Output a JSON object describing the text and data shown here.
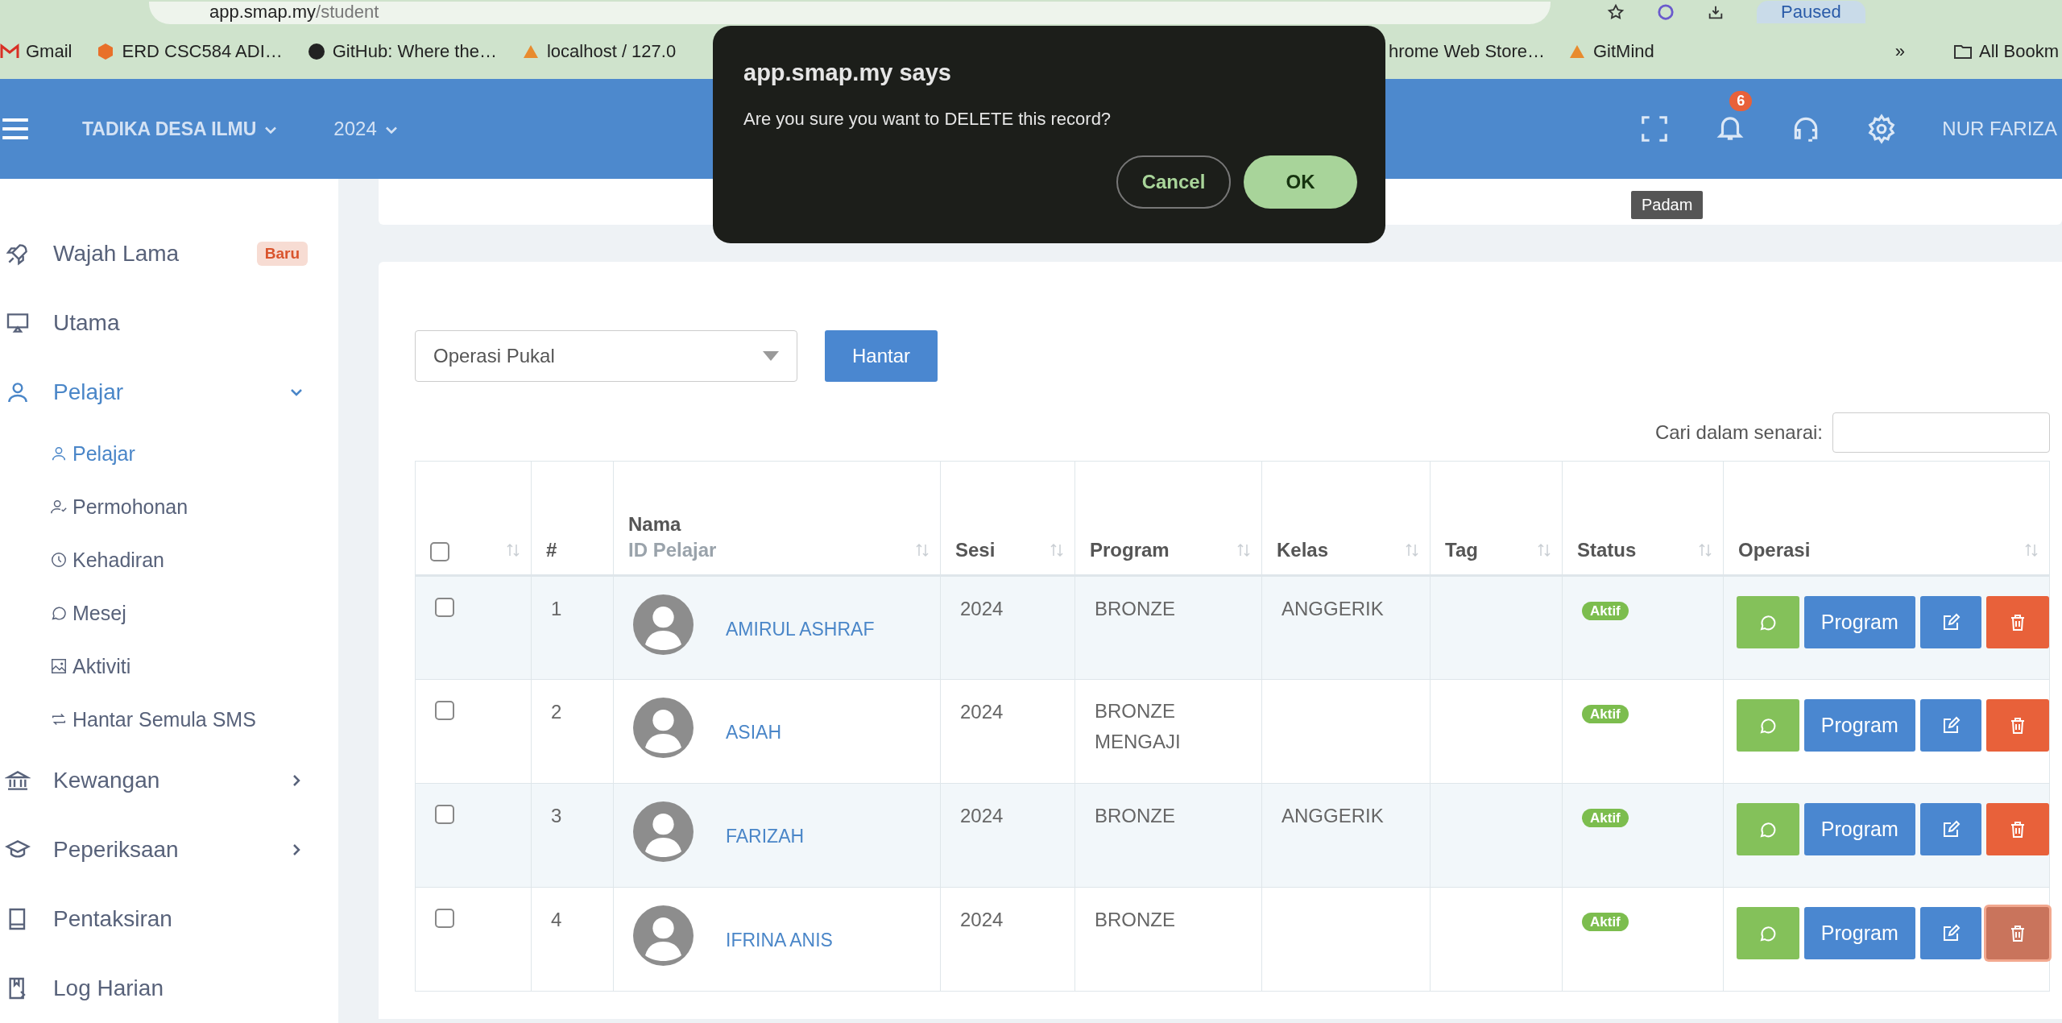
{
  "browser": {
    "url_host": "app.smap.my",
    "url_path": "/student",
    "profile_button": "Paused",
    "bookmarks": [
      {
        "label": "Gmail"
      },
      {
        "label": "ERD CSC584 ADI…"
      },
      {
        "label": "GitHub: Where the…"
      },
      {
        "label": "localhost / 127.0"
      },
      {
        "label": "hrome Web Store…"
      },
      {
        "label": "GitMind"
      }
    ],
    "more": "»",
    "all_bookmarks": "All Bookm"
  },
  "header": {
    "school": "TADIKA DESA ILMU",
    "year": "2024",
    "notification_count": "6",
    "user": "NUR FARIZA",
    "tooltip": "Padam"
  },
  "dialog": {
    "title": "app.smap.my says",
    "message": "Are you sure you want to DELETE this record?",
    "buttons": [
      {
        "label": "Cancel",
        "kind": "cancel"
      },
      {
        "label": "OK",
        "kind": "ok"
      }
    ]
  },
  "sidebar": {
    "items": [
      {
        "label": "Wajah Lama",
        "badge": "Baru",
        "selected": false
      },
      {
        "label": "Utama",
        "selected": false
      },
      {
        "label": "Pelajar",
        "selected": true,
        "expanded": true,
        "children": [
          {
            "label": "Pelajar",
            "selected": true
          },
          {
            "label": "Permohonan",
            "selected": false
          },
          {
            "label": "Kehadiran",
            "selected": false
          },
          {
            "label": "Mesej",
            "selected": false
          },
          {
            "label": "Aktiviti",
            "selected": false
          },
          {
            "label": "Hantar Semula SMS",
            "selected": false
          }
        ]
      },
      {
        "label": "Kewangan",
        "selected": false,
        "expanded": false
      },
      {
        "label": "Peperiksaan",
        "selected": false,
        "expanded": false
      },
      {
        "label": "Pentaksiran",
        "selected": false
      },
      {
        "label": "Log Harian",
        "selected": false
      }
    ]
  },
  "bulk_action": {
    "value": "Operasi Pukal",
    "submit": "Hantar"
  },
  "search": {
    "label": "Cari dalam senarai:"
  },
  "table": {
    "select_all_checked": false,
    "columns": [
      {
        "label": "#",
        "sortable": false
      },
      {
        "label": "Nama",
        "sublabel": "ID Pelajar",
        "sortable": true
      },
      {
        "label": "Sesi",
        "sortable": true
      },
      {
        "label": "Program",
        "sortable": true
      },
      {
        "label": "Kelas",
        "sortable": true
      },
      {
        "label": "Tag",
        "sortable": true
      },
      {
        "label": "Status",
        "sortable": true
      },
      {
        "label": "Operasi",
        "sortable": true
      }
    ],
    "rows": [
      {
        "checked": false,
        "number": "1",
        "name": "AMIRUL ASHRAF",
        "sesi": "2024",
        "program": "BRONZE",
        "kelas": "ANGGERIK",
        "status": "Aktif",
        "action_label": "Program",
        "delete_focused": false
      },
      {
        "checked": false,
        "number": "2",
        "name": "ASIAH",
        "sesi": "2024",
        "program": "BRONZE MENGAJI",
        "kelas": "",
        "status": "Aktif",
        "action_label": "Program",
        "delete_focused": false
      },
      {
        "checked": false,
        "number": "3",
        "name": "FARIZAH",
        "sesi": "2024",
        "program": "BRONZE",
        "kelas": "ANGGERIK",
        "status": "Aktif",
        "action_label": "Program",
        "delete_focused": false
      },
      {
        "checked": false,
        "number": "4",
        "name": "IFRINA ANIS",
        "sesi": "2024",
        "program": "BRONZE",
        "kelas": "",
        "status": "Aktif",
        "action_label": "Program",
        "delete_focused": true
      }
    ]
  }
}
